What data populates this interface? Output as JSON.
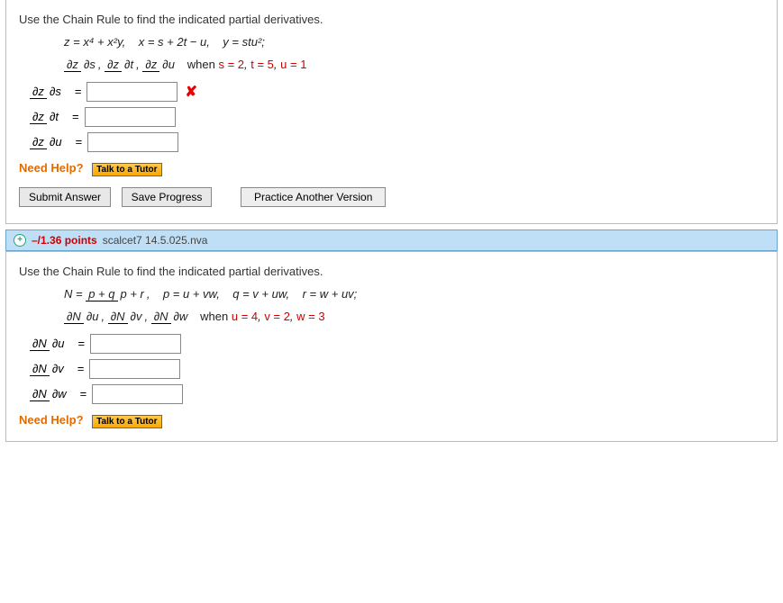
{
  "q1": {
    "instruct": "Use the Chain Rule to find the indicated partial derivatives.",
    "eq1_z": "z = x⁴ + x²y,",
    "eq1_x": "x = s + 2t − u,",
    "eq1_y": "y = stu²;",
    "when_prefix": "when ",
    "when_s": "s = 2",
    "when_t": "t = 5",
    "when_u": "u = 1",
    "dz": "∂z",
    "ds": "∂s",
    "dt": "∂t",
    "du": "∂u",
    "need_help": "Need Help?",
    "tutor": "Talk to a Tutor",
    "submit": "Submit Answer",
    "save": "Save Progress",
    "practice": "Practice Another Version"
  },
  "hdr": {
    "points": "–/1.36 points",
    "ref": "scalcet7 14.5.025.nva"
  },
  "q2": {
    "instruct": "Use the Chain Rule to find the indicated partial derivatives.",
    "N_top": "p + q",
    "N_bot": "p + r",
    "eq_p": "p = u + vw,",
    "eq_q": "q = v + uw,",
    "eq_r": "r = w + uv;",
    "when_prefix": "when ",
    "when_u": "u = 4",
    "when_v": "v = 2",
    "when_w": "w = 3",
    "dN": "∂N",
    "du": "∂u",
    "dv": "∂v",
    "dw": "∂w",
    "need_help": "Need Help?",
    "tutor": "Talk to a Tutor"
  }
}
